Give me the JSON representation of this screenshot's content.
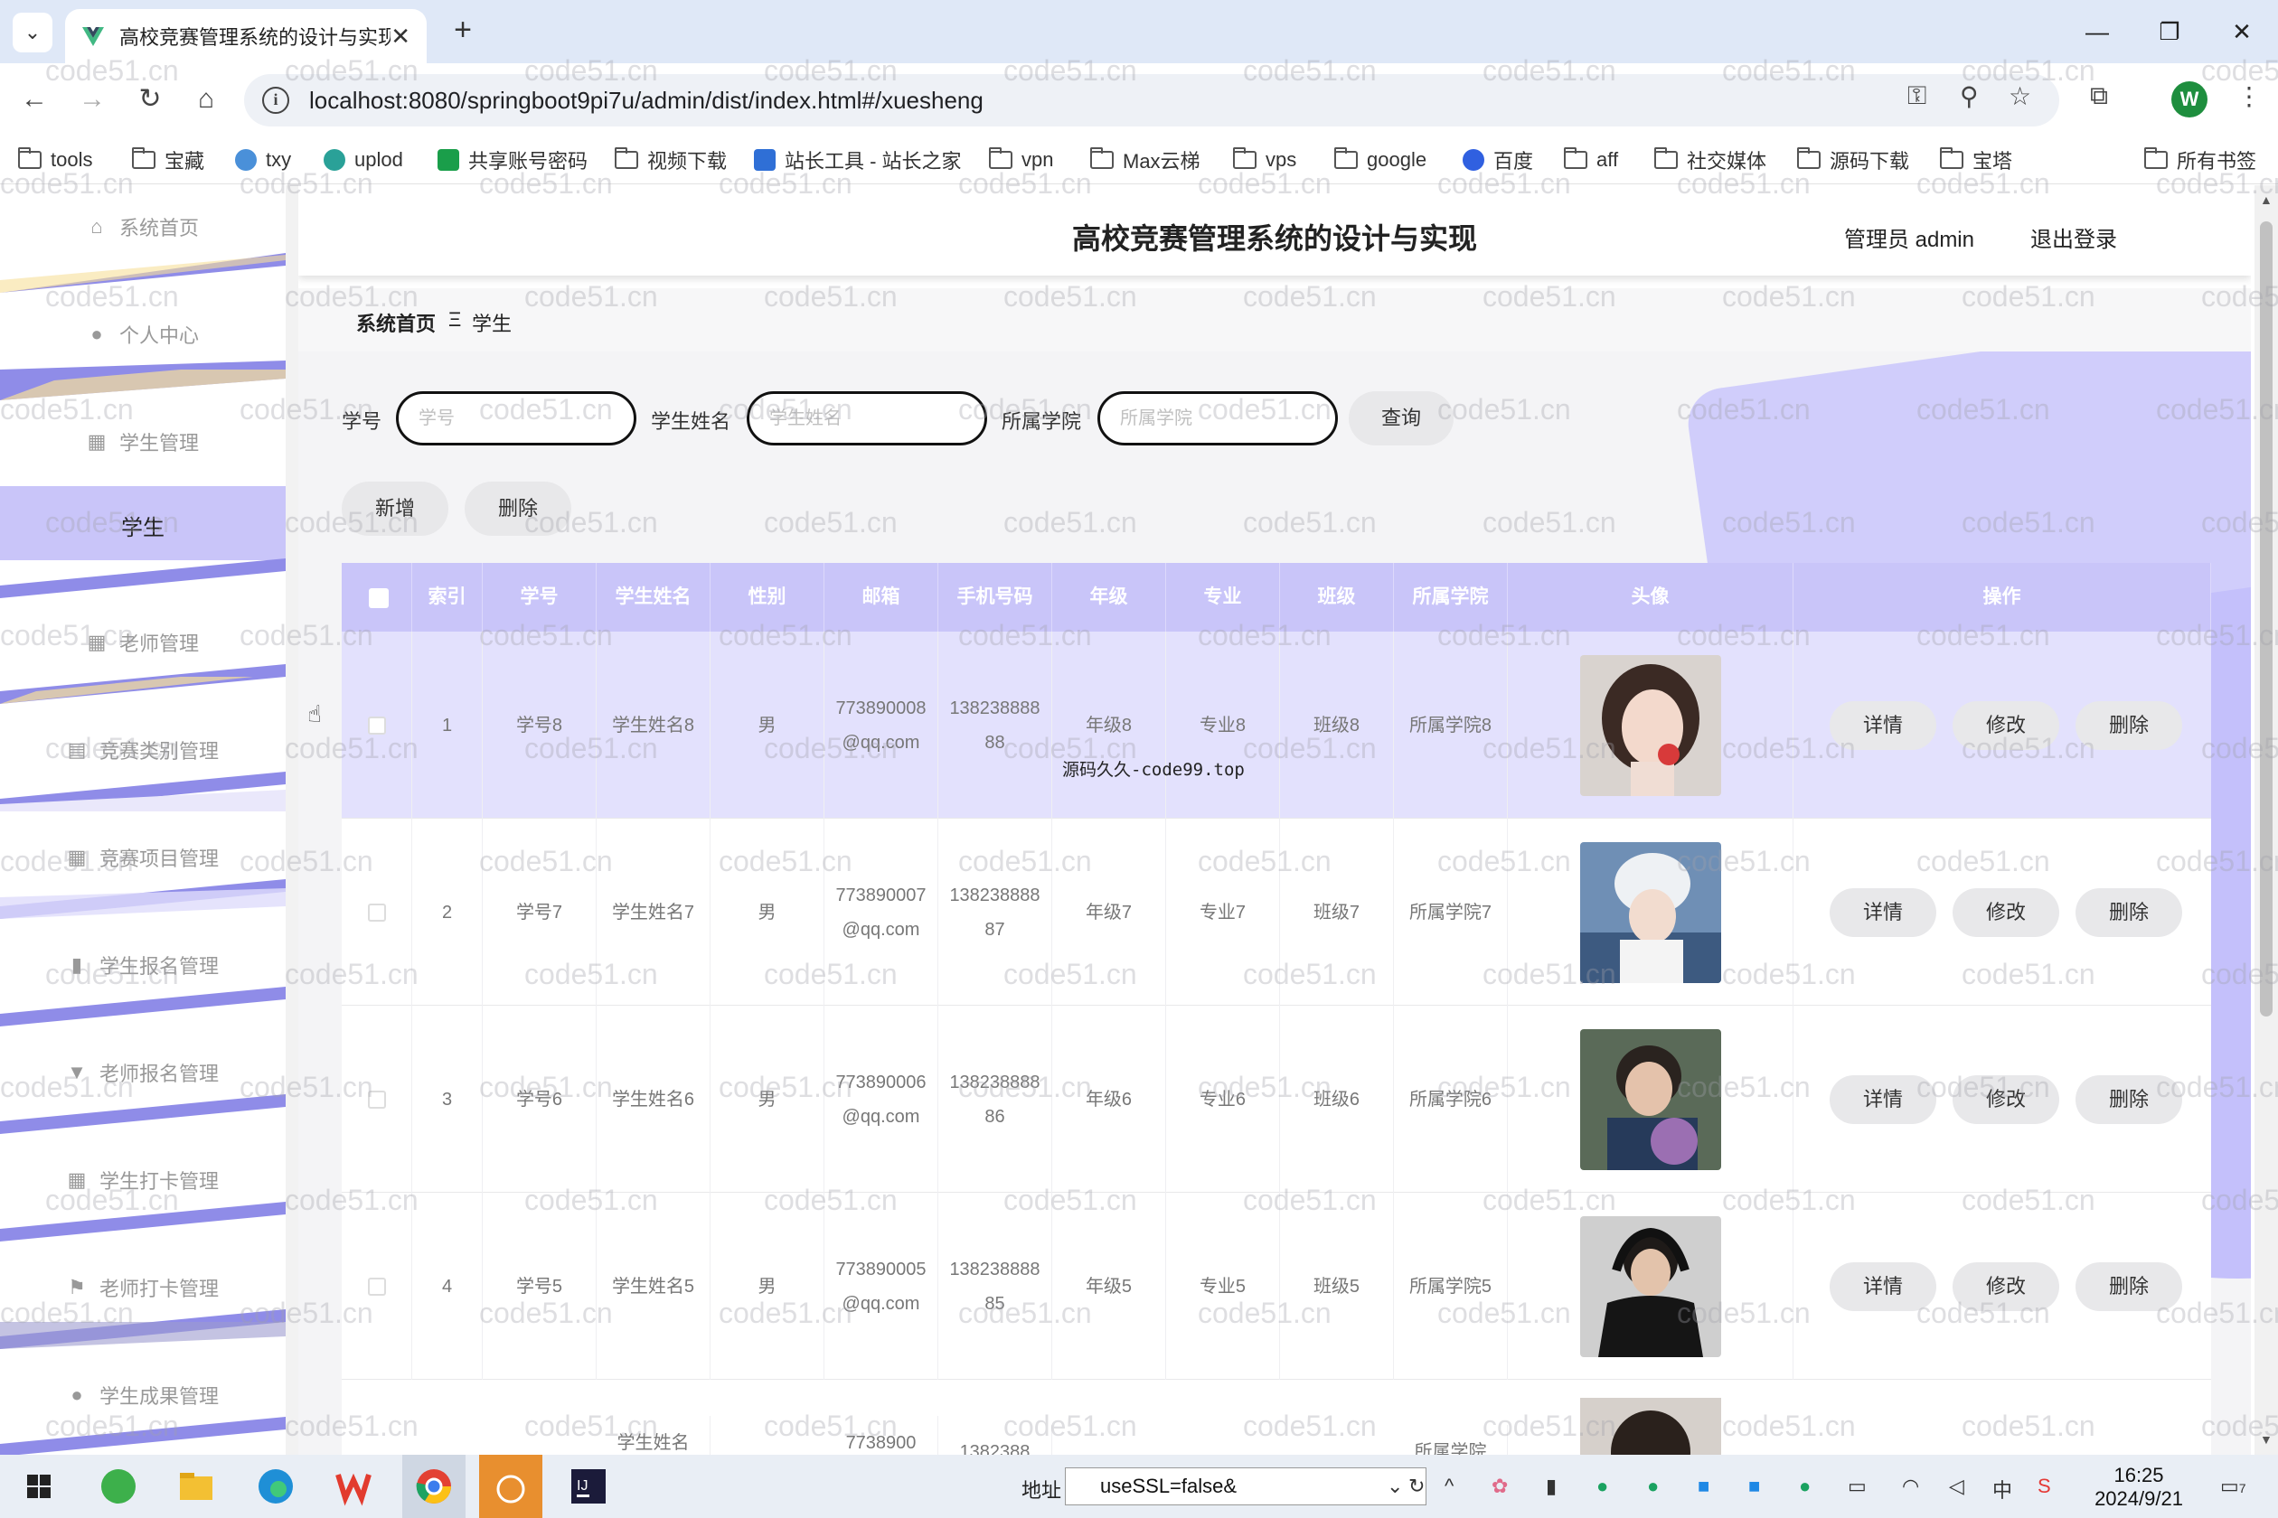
{
  "browser": {
    "tab_title": "高校竞赛管理系统的设计与实现",
    "tab_close": "✕",
    "new_tab": "+",
    "url": "localhost:8080/springboot9pi7u/admin/dist/index.html#/xuesheng",
    "profile_initial": "W",
    "bookmarks": [
      {
        "label": "tools"
      },
      {
        "label": "宝藏"
      },
      {
        "label": "txy"
      },
      {
        "label": "uplod"
      },
      {
        "label": "共享账号密码"
      },
      {
        "label": "视频下载"
      },
      {
        "label": "站长工具 - 站长之家"
      },
      {
        "label": "vpn"
      },
      {
        "label": "Max云梯"
      },
      {
        "label": "vps"
      },
      {
        "label": "google"
      },
      {
        "label": "百度"
      },
      {
        "label": "aff"
      },
      {
        "label": "社交媒体"
      },
      {
        "label": "源码下载"
      },
      {
        "label": "宝塔"
      },
      {
        "label": "所有书签"
      }
    ]
  },
  "sidebar": {
    "items": [
      {
        "label": "系统首页",
        "icon": "home-icon"
      },
      {
        "label": "个人中心",
        "icon": "user-icon"
      },
      {
        "label": "学生管理",
        "icon": "grid-icon"
      },
      {
        "label": "学生",
        "active": true
      },
      {
        "label": "老师管理",
        "icon": "grid-icon"
      },
      {
        "label": "竞赛类别管理",
        "icon": "briefcase-icon"
      },
      {
        "label": "竞赛项目管理",
        "icon": "grid-icon"
      },
      {
        "label": "学生报名管理",
        "icon": "chart-icon"
      },
      {
        "label": "老师报名管理",
        "icon": "cup-icon"
      },
      {
        "label": "学生打卡管理",
        "icon": "grid-icon"
      },
      {
        "label": "老师打卡管理",
        "icon": "flag-icon"
      },
      {
        "label": "学生成果管理",
        "icon": "bulb-icon"
      }
    ]
  },
  "header": {
    "title": "高校竞赛管理系统的设计与实现",
    "user": "管理员 admin",
    "logout": "退出登录"
  },
  "breadcrumb": {
    "home": "系统首页",
    "sep": "Ξ",
    "current": "学生"
  },
  "search": {
    "fields": [
      {
        "label": "学号",
        "placeholder": "学号"
      },
      {
        "label": "学生姓名",
        "placeholder": "学生姓名"
      },
      {
        "label": "所属学院",
        "placeholder": "所属学院"
      }
    ],
    "query_button": "查询",
    "add_button": "新增",
    "delete_button": "删除"
  },
  "table": {
    "columns": [
      "",
      "索引",
      "学号",
      "学生姓名",
      "性别",
      "邮箱",
      "手机号码",
      "年级",
      "专业",
      "班级",
      "所属学院",
      "头像",
      "操作"
    ],
    "rows": [
      {
        "index": "1",
        "id": "学号8",
        "name": "学生姓名8",
        "gender": "男",
        "email": "773890008@qq.com",
        "phone": "13823888888",
        "grade": "年级8",
        "major": "专业8",
        "class": "班级8",
        "college": "所属学院8"
      },
      {
        "index": "2",
        "id": "学号7",
        "name": "学生姓名7",
        "gender": "男",
        "email": "773890007@qq.com",
        "phone": "13823888887",
        "grade": "年级7",
        "major": "专业7",
        "class": "班级7",
        "college": "所属学院7"
      },
      {
        "index": "3",
        "id": "学号6",
        "name": "学生姓名6",
        "gender": "男",
        "email": "773890006@qq.com",
        "phone": "13823888886",
        "grade": "年级6",
        "major": "专业6",
        "class": "班级6",
        "college": "所属学院6"
      },
      {
        "index": "4",
        "id": "学号5",
        "name": "学生姓名5",
        "gender": "男",
        "email": "773890005@qq.com",
        "phone": "13823888885",
        "grade": "年级5",
        "major": "专业5",
        "class": "班级5",
        "college": "所属学院5"
      },
      {
        "index": "",
        "id": "",
        "name": "学生姓名",
        "gender": "",
        "email": "7738900",
        "phone": "1382388",
        "grade": "",
        "major": "",
        "class": "",
        "college": "所属学院"
      }
    ],
    "row_actions": [
      "详情",
      "修改",
      "删除"
    ]
  },
  "overlay_text": "源码久久-code99.top",
  "watermark": "code51.cn",
  "taskbar": {
    "addr_label": "地址",
    "addr_value": "useSSL=false&",
    "ime": "中",
    "time": "16:25",
    "date": "2024/9/21",
    "notif_count": "7"
  },
  "colors": {
    "accent": "#c9c5f9",
    "row_highlight": "#e3e1fd",
    "button": "#e8e8ea"
  }
}
